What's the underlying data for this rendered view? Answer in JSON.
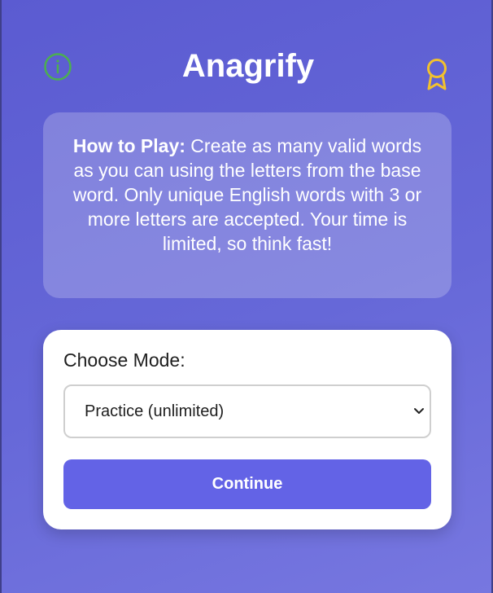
{
  "app": {
    "title": "Anagrify",
    "icons": {
      "info": "info-icon",
      "award": "award-icon"
    },
    "colors": {
      "accent": "#6363e6",
      "info": "#4caf50",
      "award": "#f2c12e"
    }
  },
  "how_to_play": {
    "heading": "How to Play:",
    "body": " Create as many valid words as you can using the letters from the base word. Only unique English words with 3 or more letters are accepted. Your time is limited, so think fast!"
  },
  "mode": {
    "label": "Choose Mode:",
    "selected": "Practice (unlimited)"
  },
  "continue_label": "Continue"
}
